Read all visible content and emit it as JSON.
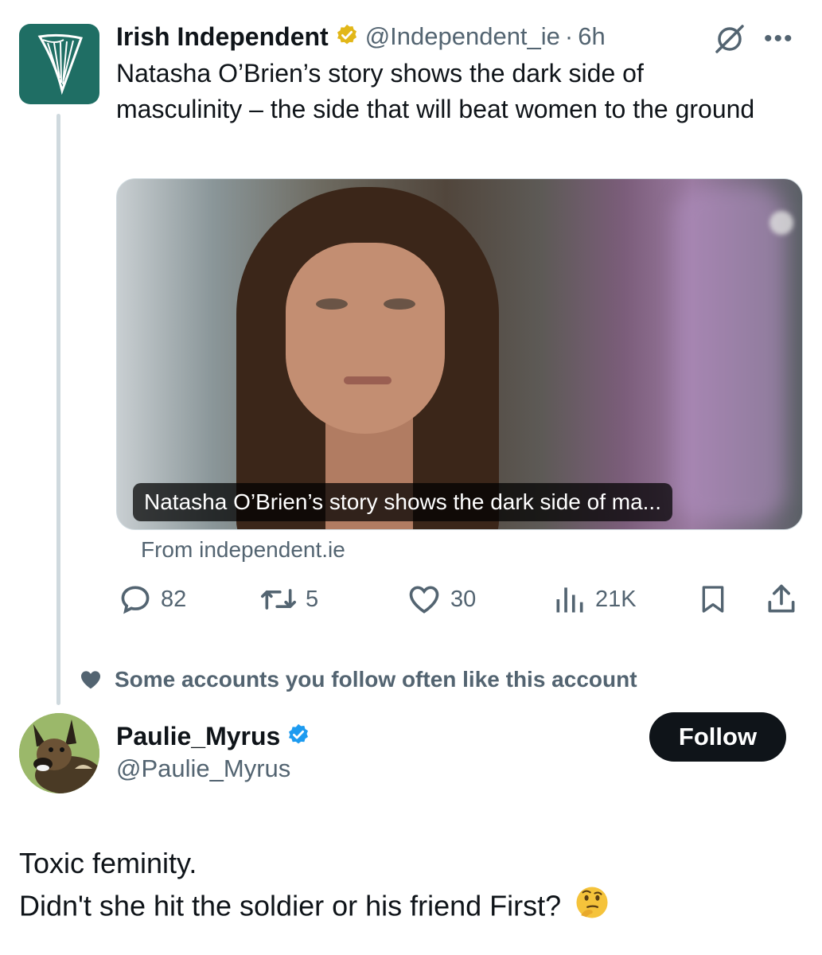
{
  "tweet": {
    "author_name": "Irish Independent",
    "author_handle": "@Independent_ie",
    "separator": "·",
    "time": "6h",
    "text": "Natasha O’Brien’s story shows the dark side of masculinity – the side that will beat women to the ground",
    "card": {
      "caption": "Natasha O’Brien’s story shows the dark side of ma...",
      "source": "From independent.ie"
    },
    "stats": {
      "replies": "82",
      "reposts": "5",
      "likes": "30",
      "views": "21K"
    },
    "more_label": "•••"
  },
  "recommendation": {
    "text": "Some accounts you follow often like this account"
  },
  "reply": {
    "author_name": "Paulie_Myrus",
    "author_handle": "@Paulie_Myrus",
    "follow_label": "Follow",
    "line1": "Toxic feminity.",
    "line2": "Didn't she hit the soldier or his friend First?",
    "emoji": "thinking-face"
  },
  "colors": {
    "text": "#0f1419",
    "secondary": "#536471",
    "gold_badge": "#e2b719",
    "blue_badge": "#1d9bf0",
    "brand_green": "#1f6e64"
  }
}
